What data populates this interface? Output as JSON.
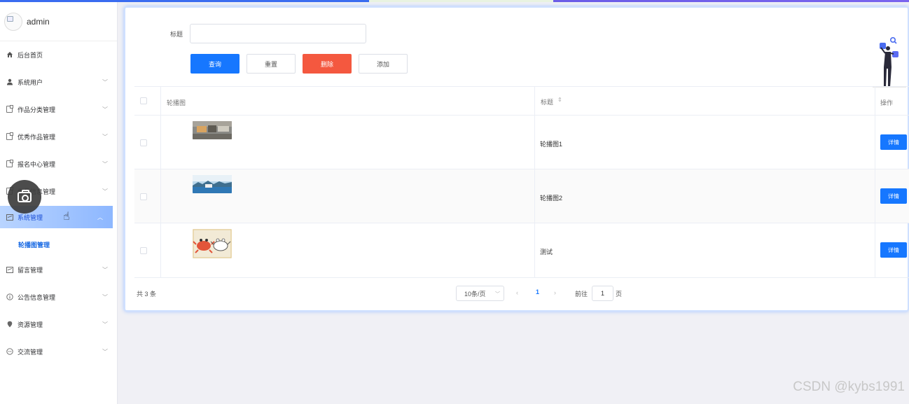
{
  "user": {
    "name": "admin"
  },
  "menu": [
    {
      "label": "后台首页",
      "icon": "home-icon",
      "expandable": false
    },
    {
      "label": "系统用户",
      "icon": "user-icon",
      "expandable": true
    },
    {
      "label": "作品分类管理",
      "icon": "doc-icon",
      "expandable": true
    },
    {
      "label": "优秀作品管理",
      "icon": "doc-icon",
      "expandable": true
    },
    {
      "label": "报名中心管理",
      "icon": "doc-icon",
      "expandable": true
    },
    {
      "label": "作品信息管理",
      "icon": "doc-icon",
      "expandable": true
    },
    {
      "label": "系统管理",
      "icon": "picture-icon",
      "expandable": true,
      "active": true
    },
    {
      "label": "留言管理",
      "icon": "picture-icon",
      "expandable": true
    },
    {
      "label": "公告信息管理",
      "icon": "info-icon",
      "expandable": true
    },
    {
      "label": "资源管理",
      "icon": "location-icon",
      "expandable": true
    },
    {
      "label": "交流管理",
      "icon": "chat-icon",
      "expandable": true
    }
  ],
  "submenu": {
    "label": "轮播图管理"
  },
  "search": {
    "label": "标题",
    "value": ""
  },
  "buttons": {
    "query": "查询",
    "reset": "重置",
    "delete": "删除",
    "add": "添加"
  },
  "table": {
    "headers": {
      "image": "轮播图",
      "title": "标题",
      "action": "操作"
    },
    "rows": [
      {
        "title": "轮播图1",
        "action": "详情",
        "thumb": "banner-room"
      },
      {
        "title": "轮播图2",
        "action": "详情",
        "thumb": "banner-lake"
      },
      {
        "title": "测试",
        "action": "详情",
        "thumb": "banner-crabs"
      }
    ]
  },
  "pagination": {
    "total": "共 3 条",
    "size": "10条/页",
    "current": "1",
    "goto": "前往",
    "page_value": "1",
    "page_unit": "页"
  },
  "watermark": "CSDN @kybs1991",
  "colors": {
    "primary": "#1677ff",
    "danger": "#f4583f",
    "active_menu": "#8db7ff"
  }
}
